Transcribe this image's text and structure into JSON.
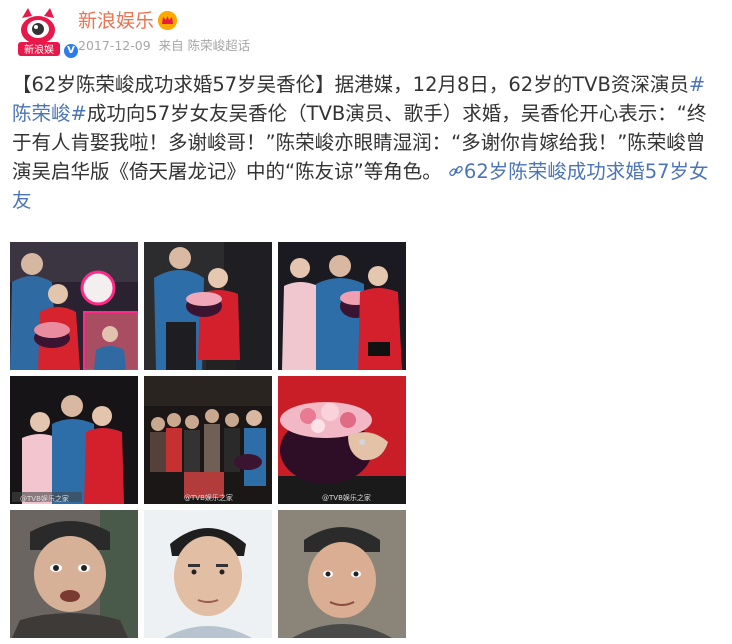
{
  "header": {
    "account_name": "新浪娱乐",
    "avatar_text": "新浪娱",
    "verified_badge": "V",
    "timestamp": "2017-12-09",
    "source": "来自 陈荣峻超话"
  },
  "post": {
    "title_open": "【",
    "title": "62岁陈荣峻成功求婚57岁吴香伦",
    "title_close": "】",
    "text_1": "据港媒，12月8日，62岁的TVB资深演员",
    "hashtag": "#陈荣峻#",
    "text_2": "成功向57岁女友吴香伦（TVB演员、歌手）求婚，吴香伦开心表示：“终于有人肯娶我啦！多谢峻哥！”陈荣峻亦眼睛湿润：“多谢你肯嫁给我！”陈荣峻曾演吴启华版《倚天屠龙记》中的“陈友谅”等角色。",
    "link_icon": "link-icon",
    "link_text": "62岁陈荣峻成功求婚57岁女友"
  },
  "watermarks": [
    "@TVB娱乐之家",
    "@TVB娱乐之家",
    "@TVB娱乐之家",
    "@TVB娱乐之家"
  ],
  "photos": [
    "photo-1",
    "photo-2",
    "photo-3",
    "photo-4",
    "photo-5",
    "photo-6",
    "photo-7",
    "photo-8",
    "photo-9"
  ],
  "colors": {
    "name": "#eb7350",
    "link": "#4c74b8",
    "meta": "#a6a6a6",
    "text": "#333333"
  }
}
